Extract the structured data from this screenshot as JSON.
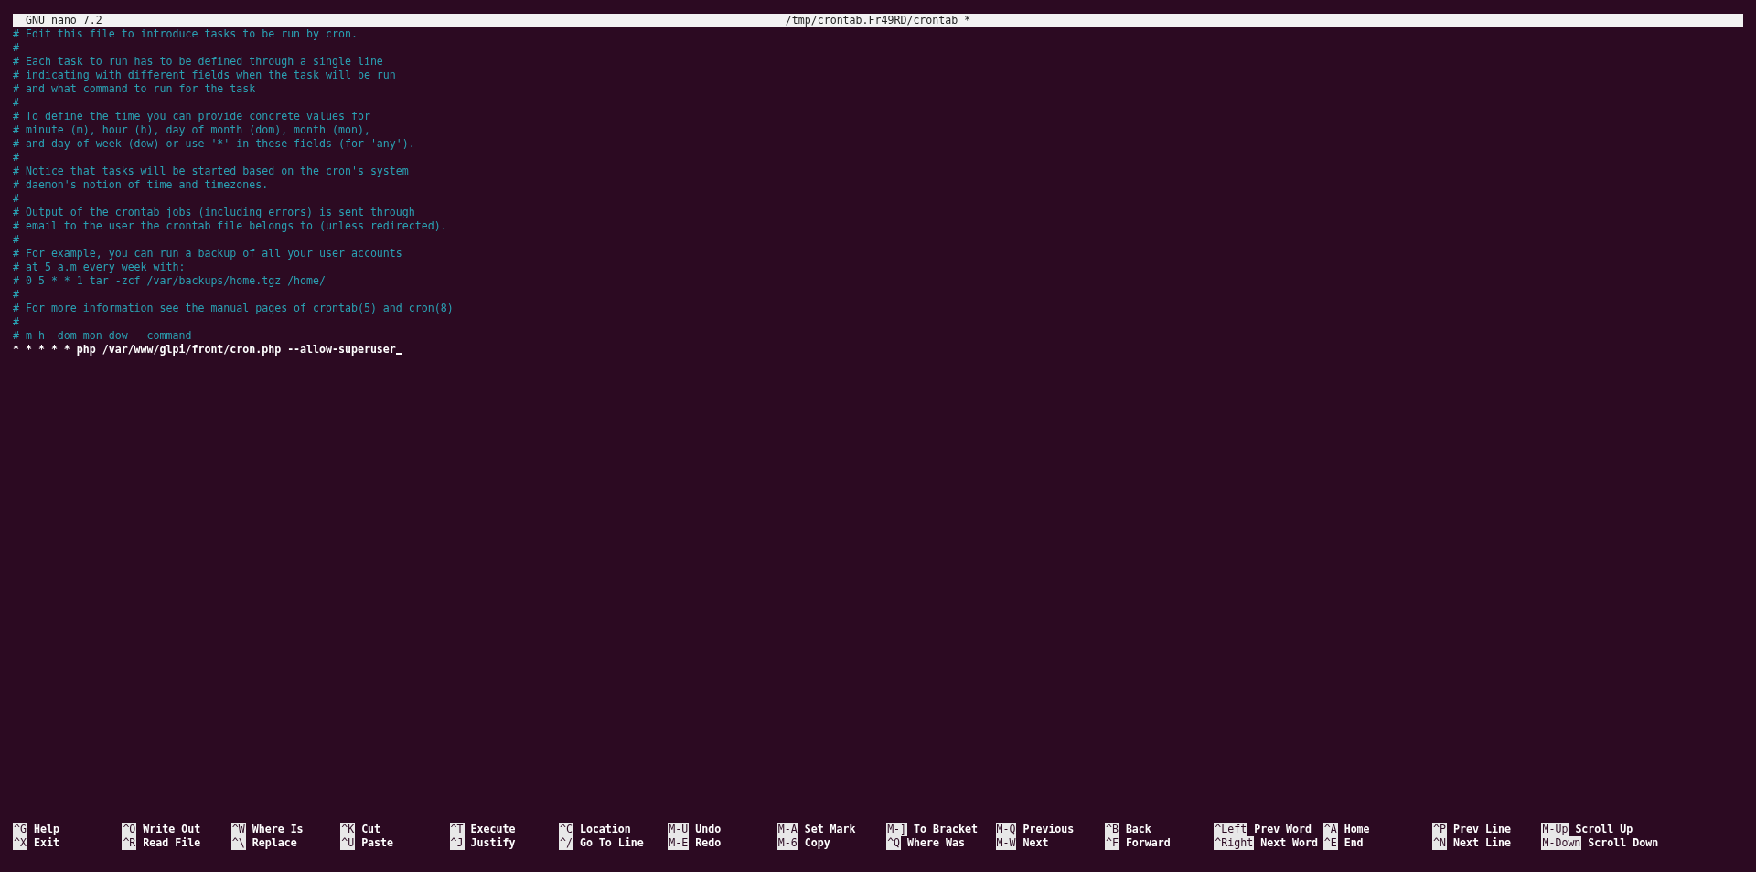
{
  "title_bar": {
    "app": "GNU nano 7.2",
    "file": "/tmp/crontab.Fr49RD/crontab *"
  },
  "lines": [
    {
      "kind": "comment",
      "text": "# Edit this file to introduce tasks to be run by cron."
    },
    {
      "kind": "comment",
      "text": "#"
    },
    {
      "kind": "comment",
      "text": "# Each task to run has to be defined through a single line"
    },
    {
      "kind": "comment",
      "text": "# indicating with different fields when the task will be run"
    },
    {
      "kind": "comment",
      "text": "# and what command to run for the task"
    },
    {
      "kind": "comment",
      "text": "#"
    },
    {
      "kind": "comment",
      "text": "# To define the time you can provide concrete values for"
    },
    {
      "kind": "comment",
      "text": "# minute (m), hour (h), day of month (dom), month (mon),"
    },
    {
      "kind": "comment",
      "text": "# and day of week (dow) or use '*' in these fields (for 'any')."
    },
    {
      "kind": "comment",
      "text": "#"
    },
    {
      "kind": "comment",
      "text": "# Notice that tasks will be started based on the cron's system"
    },
    {
      "kind": "comment",
      "text": "# daemon's notion of time and timezones."
    },
    {
      "kind": "comment",
      "text": "#"
    },
    {
      "kind": "comment",
      "text": "# Output of the crontab jobs (including errors) is sent through"
    },
    {
      "kind": "comment",
      "text": "# email to the user the crontab file belongs to (unless redirected)."
    },
    {
      "kind": "comment",
      "text": "#"
    },
    {
      "kind": "comment",
      "text": "# For example, you can run a backup of all your user accounts"
    },
    {
      "kind": "comment",
      "text": "# at 5 a.m every week with:"
    },
    {
      "kind": "comment",
      "text": "# 0 5 * * 1 tar -zcf /var/backups/home.tgz /home/"
    },
    {
      "kind": "comment",
      "text": "#"
    },
    {
      "kind": "comment",
      "text": "# For more information see the manual pages of crontab(5) and cron(8)"
    },
    {
      "kind": "comment",
      "text": "#"
    },
    {
      "kind": "comment",
      "text": "# m h  dom mon dow   command"
    },
    {
      "kind": "command",
      "text": "* * * * * php /var/www/glpi/front/cron.php --allow-superuser"
    }
  ],
  "shortcuts": [
    [
      {
        "key": "^G",
        "label": "Help"
      },
      {
        "key": "^X",
        "label": "Exit"
      }
    ],
    [
      {
        "key": "^O",
        "label": "Write Out"
      },
      {
        "key": "^R",
        "label": "Read File"
      }
    ],
    [
      {
        "key": "^W",
        "label": "Where Is"
      },
      {
        "key": "^\\",
        "label": "Replace"
      }
    ],
    [
      {
        "key": "^K",
        "label": "Cut"
      },
      {
        "key": "^U",
        "label": "Paste"
      }
    ],
    [
      {
        "key": "^T",
        "label": "Execute"
      },
      {
        "key": "^J",
        "label": "Justify"
      }
    ],
    [
      {
        "key": "^C",
        "label": "Location"
      },
      {
        "key": "^/",
        "label": "Go To Line"
      }
    ],
    [
      {
        "key": "M-U",
        "label": "Undo"
      },
      {
        "key": "M-E",
        "label": "Redo"
      }
    ],
    [
      {
        "key": "M-A",
        "label": "Set Mark"
      },
      {
        "key": "M-6",
        "label": "Copy"
      }
    ],
    [
      {
        "key": "M-]",
        "label": "To Bracket"
      },
      {
        "key": "^Q",
        "label": "Where Was"
      }
    ],
    [
      {
        "key": "M-Q",
        "label": "Previous"
      },
      {
        "key": "M-W",
        "label": "Next"
      }
    ],
    [
      {
        "key": "^B",
        "label": "Back"
      },
      {
        "key": "^F",
        "label": "Forward"
      }
    ],
    [
      {
        "key": "^Left",
        "label": "Prev Word"
      },
      {
        "key": "^Right",
        "label": "Next Word"
      }
    ],
    [
      {
        "key": "^A",
        "label": "Home"
      },
      {
        "key": "^E",
        "label": "End"
      }
    ],
    [
      {
        "key": "^P",
        "label": "Prev Line"
      },
      {
        "key": "^N",
        "label": "Next Line"
      }
    ],
    [
      {
        "key": "M-Up",
        "label": "Scroll Up"
      },
      {
        "key": "M-Down",
        "label": "Scroll Down"
      }
    ]
  ]
}
